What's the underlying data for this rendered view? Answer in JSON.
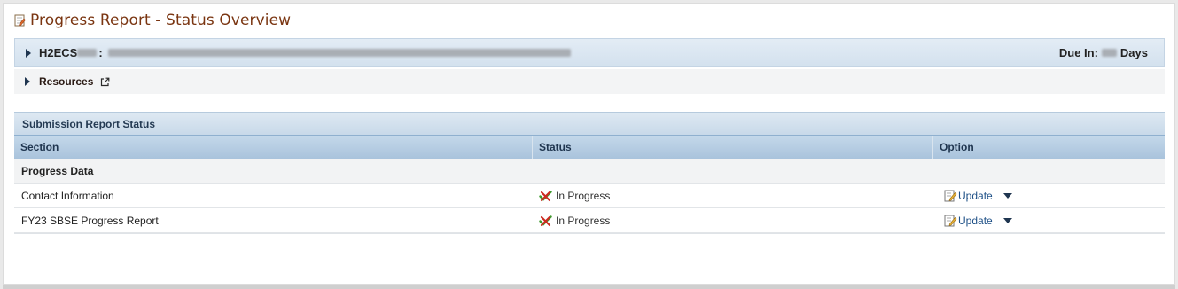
{
  "page": {
    "title": "Progress Report - Status Overview",
    "title_icon": "report-edit-icon"
  },
  "org": {
    "id_prefix": "H2ECS",
    "separator": ":",
    "due_label": "Due In:",
    "due_unit": "Days"
  },
  "resources": {
    "label": "Resources",
    "icon": "external-link-icon"
  },
  "submission": {
    "title": "Submission Report Status",
    "columns": [
      "Section",
      "Status",
      "Option"
    ],
    "group": "Progress Data",
    "rows": [
      {
        "section": "Contact Information",
        "status": "In Progress",
        "option": "Update"
      },
      {
        "section": "FY23 SBSE Progress Report",
        "status": "In Progress",
        "option": "Update"
      }
    ]
  },
  "colors": {
    "title": "#7a3511",
    "link": "#1d4f86",
    "header_bg": "#c4d8ea"
  }
}
